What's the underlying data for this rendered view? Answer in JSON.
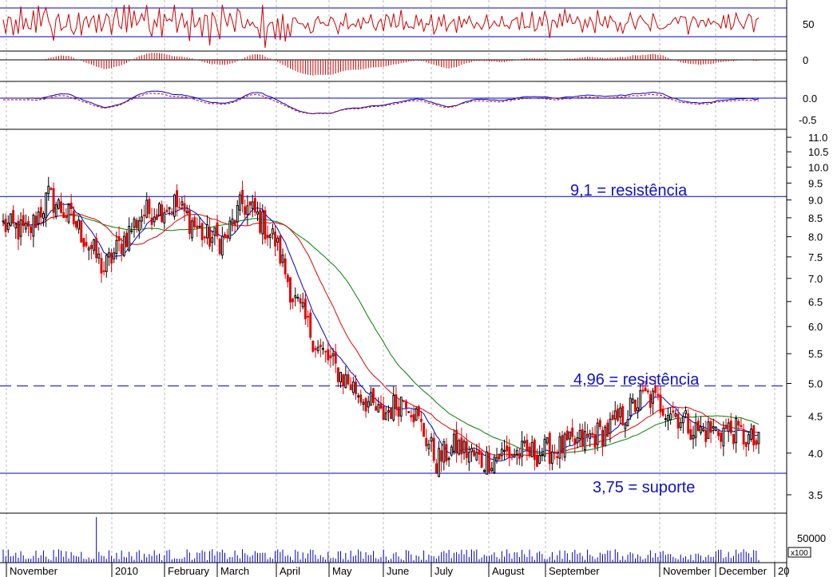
{
  "chart_data": {
    "type": "candlestick",
    "title": "",
    "colors": {
      "up": "#000000",
      "down": "#e00000",
      "ma_fast": "#0000cc",
      "ma_mid": "#dd0000",
      "ma_slow": "#008000",
      "level_line": "#0000cc",
      "oscillator": "#cc0000",
      "grid": "#bbbbbb"
    },
    "months": [
      "November",
      "2010",
      "February",
      "March",
      "April",
      "May",
      "June",
      "July",
      "August",
      "September",
      "November",
      "December",
      "20"
    ],
    "price_axis": {
      "scale": "log",
      "ticks": [
        "3.5",
        "4.0",
        "4.5",
        "5.0",
        "5.5",
        "6.0",
        "6.5",
        "7.0",
        "7.5",
        "8.0",
        "8.5",
        "9.0",
        "9.5",
        "10.0",
        "10.5",
        "11.0"
      ],
      "range": [
        3.3,
        11.2
      ]
    },
    "levels": [
      {
        "value": 9.1,
        "label": "9,1 = resistência",
        "style": "solid"
      },
      {
        "value": 4.96,
        "label": "4,96 = resistência",
        "style": "dashed"
      },
      {
        "value": 3.75,
        "label": "3,75 = suporte",
        "style": "solid"
      }
    ],
    "price_anchors": {
      "x": [
        0,
        10,
        18,
        28,
        40,
        55,
        68,
        80,
        88,
        95,
        100,
        108,
        115,
        125,
        135,
        150,
        160,
        172,
        180,
        190,
        200,
        212,
        225,
        240,
        255,
        265,
        275,
        280,
        290,
        300
      ],
      "close": [
        8.3,
        8.1,
        9.1,
        8.4,
        7.2,
        8.6,
        8.9,
        8.0,
        7.9,
        8.9,
        8.6,
        7.9,
        6.6,
        5.6,
        5.1,
        4.5,
        4.8,
        3.9,
        4.1,
        3.9,
        4.0,
        4.0,
        4.1,
        4.3,
        4.8,
        4.6,
        4.3,
        4.3,
        4.3,
        4.1
      ]
    },
    "volume_axis": {
      "ticks": [
        "50000"
      ],
      "multiplier": "x100"
    },
    "volume_spike": {
      "label": "2010",
      "note": ""
    },
    "rsi_axis": {
      "ticks": [
        "50"
      ]
    },
    "histogram_axis": {
      "ticks": [
        "0"
      ]
    },
    "macd_axis": {
      "ticks": [
        "0.0",
        "-0.5"
      ]
    }
  }
}
